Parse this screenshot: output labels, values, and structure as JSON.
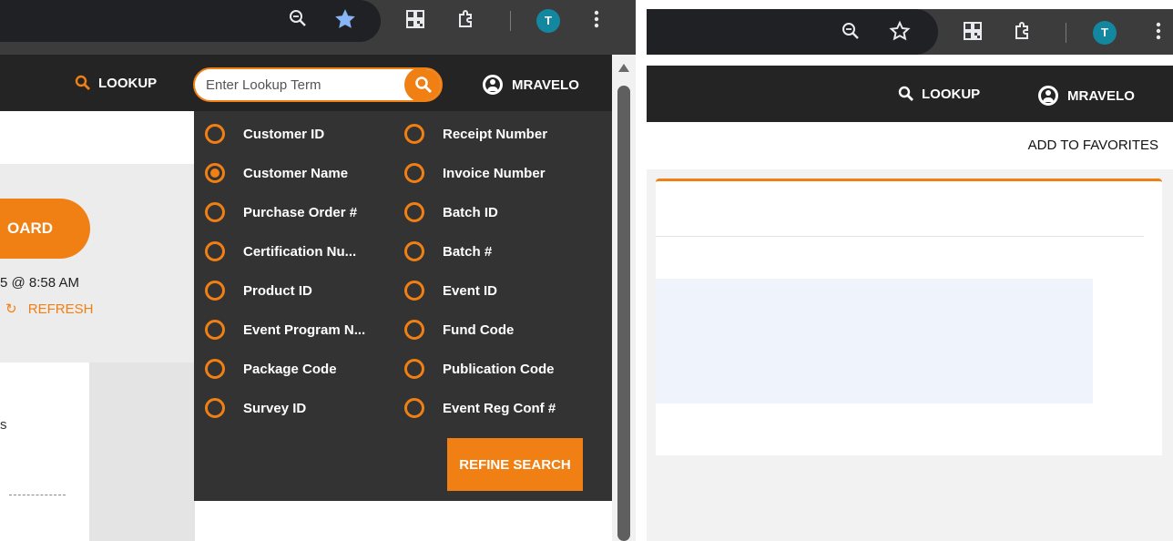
{
  "browser": {
    "avatar_letter": "T"
  },
  "header": {
    "lookup_label": "LOOKUP",
    "user_label": "MRAVELO",
    "search_placeholder": "Enter Lookup Term"
  },
  "lookup_options": {
    "left": [
      {
        "label": "Customer ID",
        "checked": false
      },
      {
        "label": "Customer Name",
        "checked": true
      },
      {
        "label": "Purchase Order #",
        "checked": false
      },
      {
        "label": "Certification Nu...",
        "checked": false
      },
      {
        "label": "Product ID",
        "checked": false
      },
      {
        "label": "Event Program N...",
        "checked": false
      },
      {
        "label": "Package Code",
        "checked": false
      },
      {
        "label": "Survey ID",
        "checked": false
      }
    ],
    "right": [
      {
        "label": "Receipt Number",
        "checked": false
      },
      {
        "label": "Invoice Number",
        "checked": false
      },
      {
        "label": "Batch ID",
        "checked": false
      },
      {
        "label": "Batch #",
        "checked": false
      },
      {
        "label": "Event ID",
        "checked": false
      },
      {
        "label": "Fund Code",
        "checked": false
      },
      {
        "label": "Publication Code",
        "checked": false
      },
      {
        "label": "Event Reg Conf #",
        "checked": false
      }
    ],
    "refine_label": "REFINE SEARCH"
  },
  "background_page": {
    "dashboard_label": "OARD",
    "timestamp": "5 @ 8:58 AM",
    "refresh_label": "REFRESH",
    "card_text": "s"
  },
  "right_panel": {
    "lookup_label": "LOOKUP",
    "user_label": "MRAVELO",
    "favorites_label": "ADD TO FAVORITES"
  },
  "colors": {
    "accent": "#f07f14",
    "dropdown_bg": "#333333",
    "app_bar": "#242424",
    "avatar": "#13879f"
  }
}
